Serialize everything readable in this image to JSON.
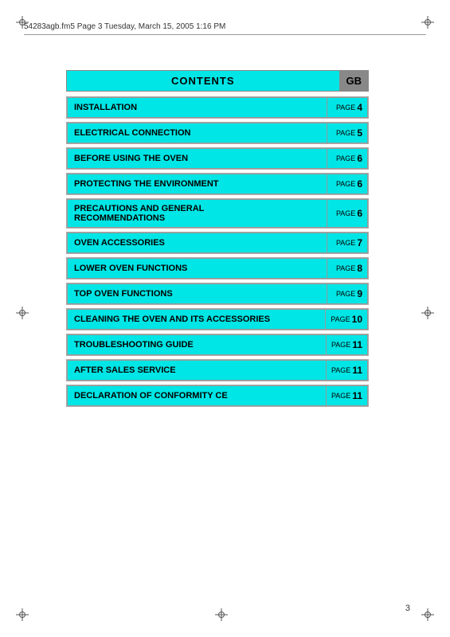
{
  "header": {
    "file_info": "54283agb.fm5  Page 3  Tuesday, March 15, 2005  1:16 PM"
  },
  "contents": {
    "title": "CONTENTS",
    "gb_label": "GB",
    "items": [
      {
        "label": "INSTALLATION",
        "page_word": "PAGE",
        "page_num": "4"
      },
      {
        "label": "ELECTRICAL CONNECTION",
        "page_word": "PAGE",
        "page_num": "5"
      },
      {
        "label": "BEFORE USING THE OVEN",
        "page_word": "PAGE",
        "page_num": "6"
      },
      {
        "label": "PROTECTING THE ENVIRONMENT",
        "page_word": "PAGE",
        "page_num": "6"
      },
      {
        "label": "PRECAUTIONS AND GENERAL\nRECOMMENDATIONS",
        "page_word": "PAGE",
        "page_num": "6"
      },
      {
        "label": "OVEN ACCESSORIES",
        "page_word": "PAGE",
        "page_num": "7"
      },
      {
        "label": "LOWER OVEN FUNCTIONS",
        "page_word": "PAGE",
        "page_num": "8"
      },
      {
        "label": "TOP OVEN FUNCTIONS",
        "page_word": "PAGE",
        "page_num": "9"
      },
      {
        "label": "CLEANING THE OVEN AND ITS ACCESSORIES",
        "page_word": "PAGE",
        "page_num": "10"
      },
      {
        "label": "TROUBLESHOOTING GUIDE",
        "page_word": "PAGE",
        "page_num": "11"
      },
      {
        "label": "AFTER SALES SERVICE",
        "page_word": "PAGE",
        "page_num": "11"
      },
      {
        "label": "DECLARATION OF CONFORMITY CE",
        "page_word": "PAGE",
        "page_num": "11"
      }
    ]
  },
  "footer": {
    "page_number": "3"
  }
}
